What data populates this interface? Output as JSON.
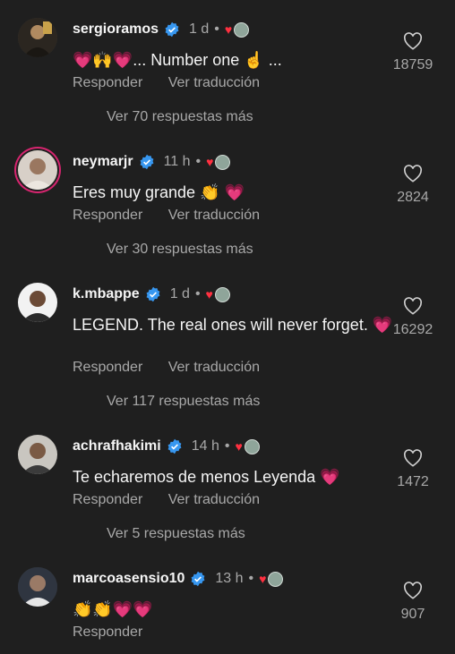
{
  "comments": [
    {
      "user": "sergioramos",
      "time": "1 d",
      "text": "... Number one ☝️ ...",
      "emoji_prefix": "💗🙌💗",
      "reply_label": "Responder",
      "translate_label": "Ver traducción",
      "likes": "18759",
      "more_replies": "Ver 70 respuestas más"
    },
    {
      "user": "neymarjr",
      "time": "11 h",
      "text": "Eres muy grande 👏 💗",
      "reply_label": "Responder",
      "translate_label": "Ver traducción",
      "likes": "2824",
      "more_replies": "Ver 30 respuestas más"
    },
    {
      "user": "k.mbappe",
      "time": "1 d",
      "text": "LEGEND. The real ones will never forget. 💗",
      "reply_label": "Responder",
      "translate_label": "Ver traducción",
      "likes": "16292",
      "more_replies": "Ver 117 respuestas más"
    },
    {
      "user": "achrafhakimi",
      "time": "14 h",
      "text": "Te echaremos de menos Leyenda 💗",
      "reply_label": "Responder",
      "translate_label": "Ver traducción",
      "likes": "1472",
      "more_replies": "Ver 5 respuestas más"
    },
    {
      "user": "marcoasensio10",
      "time": "13 h",
      "text": "👏👏💗💗",
      "reply_label": "Responder",
      "likes": "907"
    }
  ],
  "colors": {
    "background": "#1f1f1f",
    "text": "#f5f5f5",
    "secondary": "#a8a8a8",
    "verified": "#3797f0",
    "heart": "#ff3b6b"
  },
  "separator": "•"
}
